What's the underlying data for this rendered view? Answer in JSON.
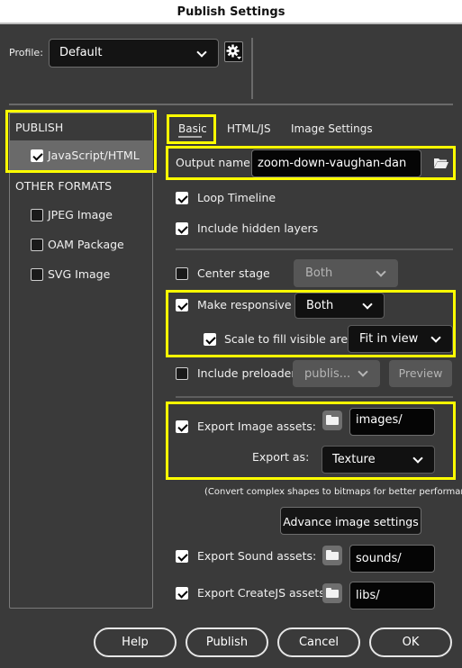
{
  "window": {
    "title": "Publish Settings"
  },
  "profile": {
    "label": "Profile:",
    "value": "Default",
    "settings_icon": "gear-icon"
  },
  "sidebar": {
    "publish_header": "PUBLISH",
    "publish_items": [
      {
        "label": "JavaScript/HTML",
        "checked": true,
        "selected": true
      }
    ],
    "other_header": "OTHER FORMATS",
    "other_items": [
      {
        "label": "JPEG Image",
        "checked": false
      },
      {
        "label": "OAM Package",
        "checked": false
      },
      {
        "label": "SVG Image",
        "checked": false
      }
    ]
  },
  "tabs": [
    {
      "label": "Basic",
      "active": true
    },
    {
      "label": "HTML/JS",
      "active": false
    },
    {
      "label": "Image Settings",
      "active": false
    }
  ],
  "basic": {
    "output_name": {
      "label": "Output name:",
      "value": "zoom-down-vaughan-dan"
    },
    "loop_timeline": {
      "label": "Loop Timeline",
      "checked": true
    },
    "include_hidden_layers": {
      "label": "Include hidden layers",
      "checked": true
    },
    "center_stage": {
      "label": "Center stage",
      "checked": false,
      "dropdown": "Both",
      "enabled": false
    },
    "make_responsive": {
      "label": "Make responsive",
      "checked": true,
      "dropdown": "Both"
    },
    "scale_to_fill": {
      "label": "Scale to fill visible area",
      "checked": true,
      "dropdown": "Fit in view"
    },
    "include_preloader": {
      "label": "Include preloader",
      "checked": false,
      "dropdown": "publis...",
      "preview_label": "Preview",
      "enabled": false
    },
    "export_image_assets": {
      "label": "Export Image assets:",
      "checked": true,
      "path": "images/"
    },
    "export_as": {
      "label": "Export as:",
      "value": "Texture"
    },
    "hint": "(Convert complex shapes to bitmaps for better performance)",
    "advance_button": "Advance image settings",
    "export_sound_assets": {
      "label": "Export Sound assets:",
      "checked": true,
      "path": "sounds/"
    },
    "export_createjs_assets": {
      "label": "Export CreateJS assets:",
      "checked": true,
      "path": "libs/"
    }
  },
  "footer": {
    "help": "Help",
    "publish": "Publish",
    "cancel": "Cancel",
    "ok": "OK"
  },
  "colors": {
    "highlight": "#ffff00",
    "background": "#3a3a3a",
    "selected_row": "#6a6a6a"
  }
}
